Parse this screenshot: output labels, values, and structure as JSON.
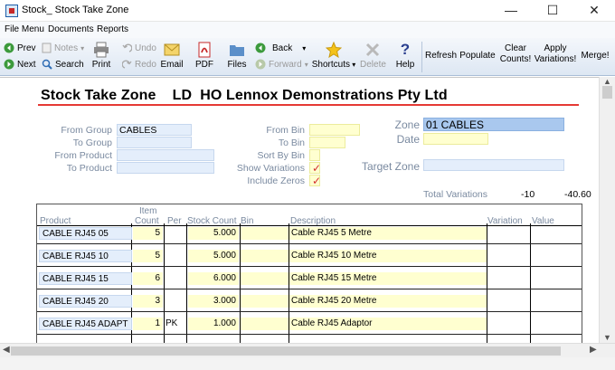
{
  "window": {
    "title": "Stock_ Stock Take Zone",
    "minimize": "—",
    "maximize": "☐",
    "close": "✕"
  },
  "menu": [
    "File Menu",
    "Documents",
    "Reports"
  ],
  "toolbar": {
    "prev": "Prev",
    "next": "Next",
    "notes": "Notes",
    "search": "Search",
    "undo": "Undo",
    "redo": "Redo",
    "print": "Print",
    "email": "Email",
    "pdf": "PDF",
    "files": "Files",
    "back": "Back",
    "forward": "Forward",
    "shortcuts": "Shortcuts",
    "delete": "Delete",
    "help": "Help",
    "refresh": "Refresh",
    "populate": "Populate",
    "clear_counts": [
      "Clear",
      "Counts!"
    ],
    "apply_variations": [
      "Apply",
      "Variations!"
    ],
    "merge": "Merge!"
  },
  "heading": "Stock Take Zone    LD  HO Lennox Demonstrations Pty Ltd",
  "filters": {
    "from_group_label": "From Group",
    "from_group": "CABLES",
    "to_group_label": "To Group",
    "to_group": "",
    "from_product_label": "From Product",
    "from_product": "",
    "to_product_label": "To Product",
    "to_product": "",
    "from_bin_label": "From Bin",
    "from_bin": "",
    "to_bin_label": "To Bin",
    "to_bin": "",
    "sort_by_bin_label": "Sort By Bin",
    "sort_by_bin": "",
    "show_variations_label": "Show Variations",
    "show_variations": "✓",
    "include_zeros_label": "Include Zeros",
    "include_zeros": "✓",
    "zone_label": "Zone",
    "zone": "01 CABLES",
    "date_label": "Date",
    "date": "",
    "target_zone_label": "Target Zone",
    "target_zone": ""
  },
  "totals": {
    "label": "Total Variations",
    "count": "-10",
    "value": "-40.60"
  },
  "grid": {
    "headers": {
      "product": "Product",
      "item_count_1": "Item",
      "item_count_2": "Count",
      "per": "Per",
      "stock_count": "Stock Count",
      "bin": "Bin",
      "description": "Description",
      "variation": "Variation",
      "value": "Value"
    },
    "rows": [
      {
        "product": "CABLE RJ45 05",
        "count": "5",
        "per": "",
        "stock": "5.000",
        "bin": "",
        "description": "Cable RJ45 5 Metre"
      },
      {
        "product": "CABLE RJ45 10",
        "count": "5",
        "per": "",
        "stock": "5.000",
        "bin": "",
        "description": "Cable RJ45 10 Metre"
      },
      {
        "product": "CABLE RJ45 15",
        "count": "6",
        "per": "",
        "stock": "6.000",
        "bin": "",
        "description": "Cable RJ45 15 Metre"
      },
      {
        "product": "CABLE RJ45 20",
        "count": "3",
        "per": "",
        "stock": "3.000",
        "bin": "",
        "description": "Cable RJ45 20 Metre"
      },
      {
        "product": "CABLE RJ45 ADAPT",
        "count": "1",
        "per": "PK",
        "stock": "1.000",
        "bin": "",
        "description": "Cable RJ45 Adaptor"
      }
    ]
  }
}
